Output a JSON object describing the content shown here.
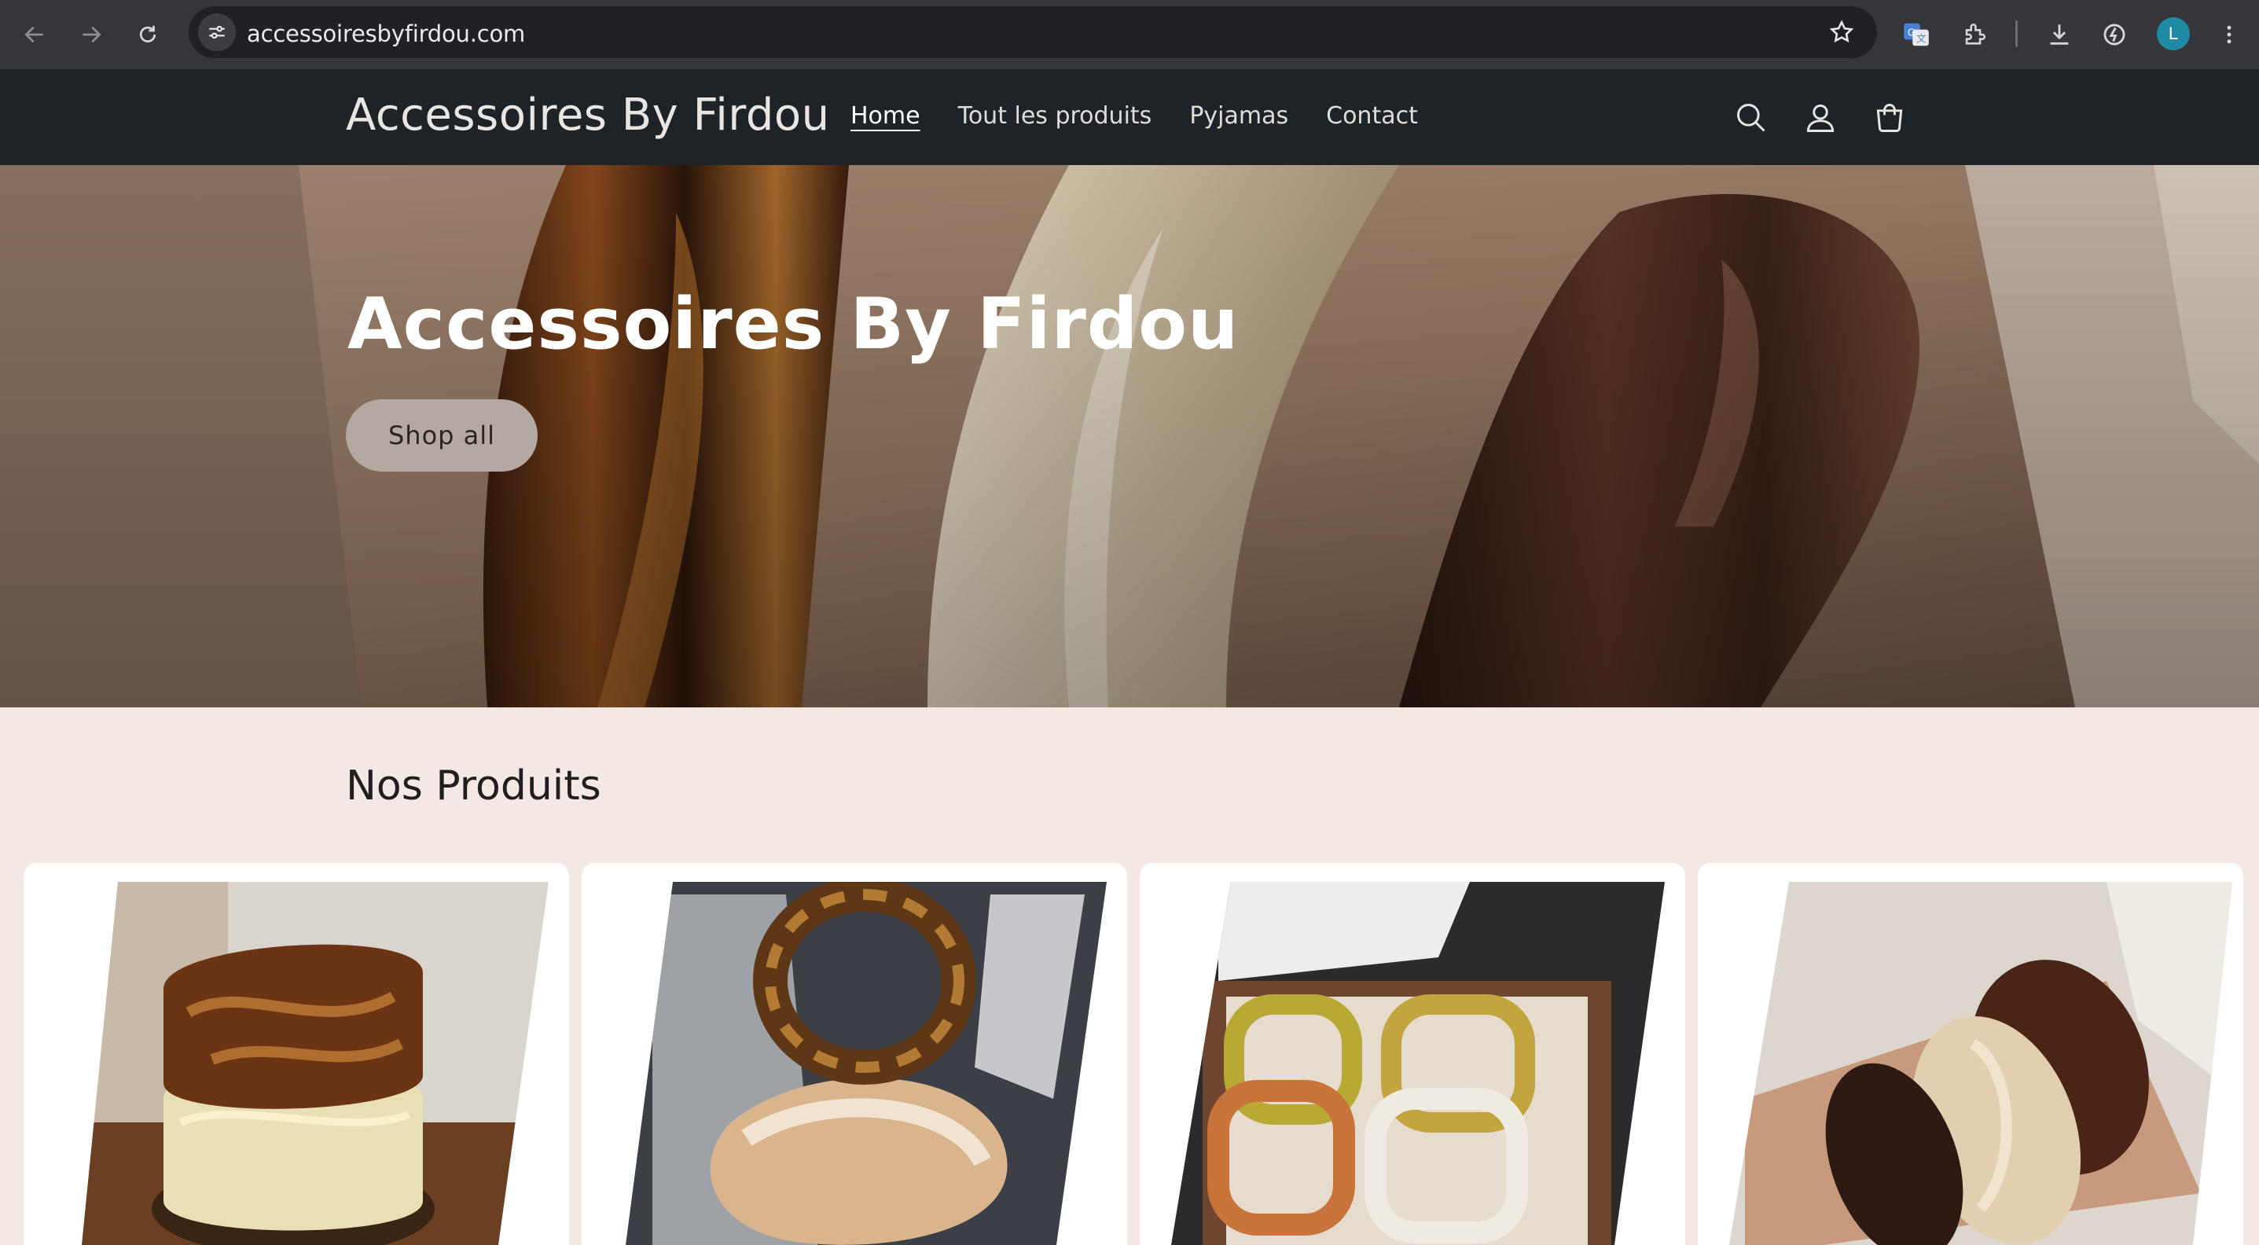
{
  "browser": {
    "url": "accessoiresbyfirdou.com",
    "profile_initial": "L",
    "icons": [
      "back-icon",
      "forward-icon",
      "reload-icon",
      "site-info-icon",
      "bookmark-star-icon",
      "google-translate-icon",
      "extensions-icon",
      "download-icon",
      "performance-icon",
      "profile-avatar",
      "more-menu-icon"
    ]
  },
  "header": {
    "logo": "Accessoires By Firdou",
    "nav": [
      {
        "label": "Home",
        "active": true
      },
      {
        "label": "Tout les produits",
        "active": false
      },
      {
        "label": "Pyjamas",
        "active": false
      },
      {
        "label": "Contact",
        "active": false
      }
    ],
    "icons": [
      "search-icon",
      "account-icon",
      "cart-icon"
    ]
  },
  "hero": {
    "title": "Accessoires By Firdou",
    "button_label": "Shop all"
  },
  "products": {
    "title": "Nos Produits",
    "cards": [
      {
        "image": "stacked-amber-and-cream-bangles"
      },
      {
        "image": "tortoiseshell-bangles-on-hand"
      },
      {
        "image": "four-colored-square-bangles"
      },
      {
        "image": "brown-and-beige-bangles-on-wrist"
      }
    ]
  },
  "colors": {
    "chrome_bg": "#35363a",
    "header_bg": "#1e2328",
    "page_bg": "#f3e8e3",
    "hero_button": "#b3a9a2"
  }
}
